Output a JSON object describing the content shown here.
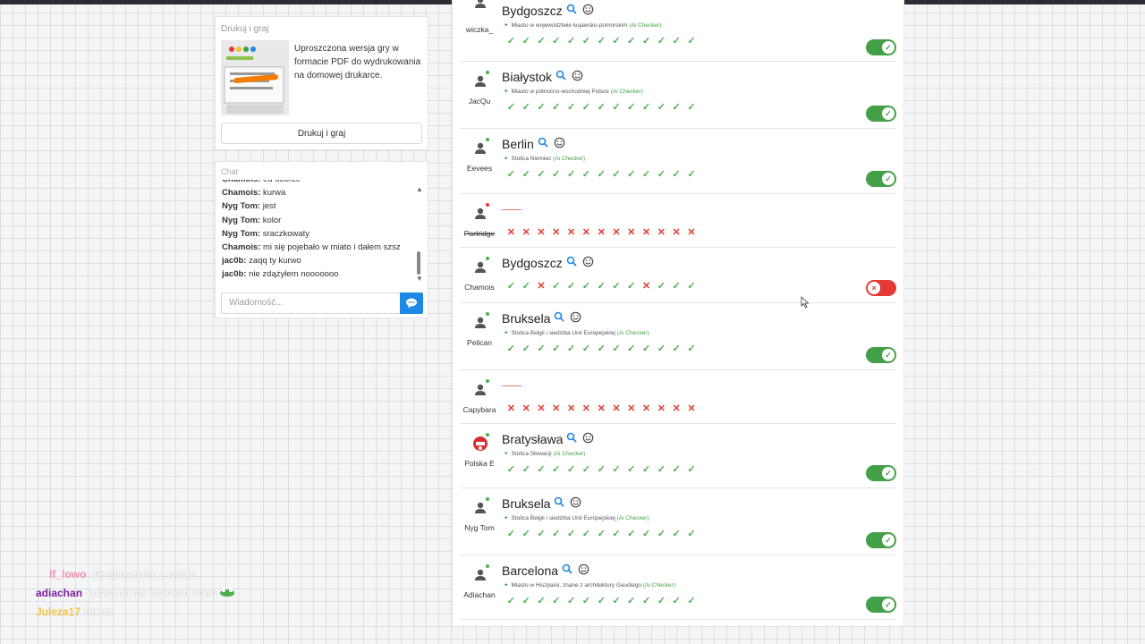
{
  "print": {
    "title": "Drukuj i graj",
    "description": "Uproszczona wersja gry w formacie PDF do wydrukowania na domowej drukarce.",
    "button": "Drukuj i graj"
  },
  "chat": {
    "title": "Chat",
    "placeholder": "Wiadomość...",
    "messages": [
      {
        "user": "Chamois:",
        "text": "eu dobrze"
      },
      {
        "user": "Chamois:",
        "text": "kurwa"
      },
      {
        "user": "Nyg Tom:",
        "text": "jest"
      },
      {
        "user": "Nyg Tom:",
        "text": "kolor"
      },
      {
        "user": "Nyg Tom:",
        "text": "sraczkowaty"
      },
      {
        "user": "Chamois:",
        "text": "mi się pojebało w miato i dałem szsz"
      },
      {
        "user": "jac0b:",
        "text": "zaqq ty kurwo"
      },
      {
        "user": "jac0b:",
        "text": "nie zdążyłem nooooooo"
      }
    ]
  },
  "answers": [
    {
      "player": "wiczka_",
      "word": "Bydgoszcz",
      "desc": "Miasto w województwie kujawsko-pomorskim",
      "ai": "(Ai Checker)",
      "votes": "ccccccccccccc",
      "toggle": "on",
      "online": true,
      "strike": false
    },
    {
      "player": "JacQu",
      "word": "Białystok",
      "desc": "Miasto w północno-wschodniej Polsce",
      "ai": "(Ai Checker)",
      "votes": "ccccccccccccc",
      "toggle": "on",
      "online": true,
      "strike": false
    },
    {
      "player": "Eevees",
      "word": "Berlin",
      "desc": "Stolica Niemiec",
      "ai": "(Ai Checker)",
      "votes": "ccccccccccccc",
      "toggle": "on",
      "online": true,
      "strike": false
    },
    {
      "player": "Partridge",
      "word": "",
      "desc": "",
      "ai": "",
      "votes": "xxxxxxxxxxxxx",
      "toggle": "none",
      "online": false,
      "strike": true
    },
    {
      "player": "Chamois",
      "word": "Bydgoszcz",
      "desc": "",
      "ai": "",
      "votes": "ccxccccccxccc",
      "toggle": "off",
      "online": true,
      "strike": false
    },
    {
      "player": "Pelican",
      "word": "Bruksela",
      "desc": "Stolica Belgii i siedziba Unii Europejskiej",
      "ai": "(Ai Checker)",
      "votes": "ccccccccccccc",
      "toggle": "on",
      "online": true,
      "strike": false
    },
    {
      "player": "Capybara",
      "word": "",
      "desc": "",
      "ai": "",
      "votes": "xxxxxxxxxxxxx",
      "toggle": "none",
      "online": true,
      "strike": false
    },
    {
      "player": "Polska E",
      "word": "Bratysława",
      "desc": "Stolica Słowacji",
      "ai": "(Ai Checker)",
      "votes": "ccccccccccccc",
      "toggle": "on",
      "online": true,
      "strike": false
    },
    {
      "player": "Nyg Tom",
      "word": "Bruksela",
      "desc": "Stolica Belgii i siedziba Unii Europejskiej",
      "ai": "(Ai Checker)",
      "votes": "ccccccccccccc",
      "toggle": "on",
      "online": true,
      "strike": false
    },
    {
      "player": "Adiachan",
      "word": "Barcelona",
      "desc": "Miasto w Hiszpanii, znane z architektury Gaudiego",
      "ai": "(Ai Checker)",
      "votes": "ccccccccccccc",
      "toggle": "on",
      "online": true,
      "strike": false
    }
  ],
  "overlay": [
    {
      "user": "lf_lowo",
      "text": "ale spocepiec z ciebie",
      "color": "#f48fb1"
    },
    {
      "user": "adiachan",
      "text": "kurwa co tak szybkoo nooo",
      "color": "#7b1fa2"
    },
    {
      "user": "Juleza17",
      "text": "rel oh",
      "color": "#f4c542"
    }
  ],
  "colors": {
    "ok": "#4caf50",
    "no": "#e53935",
    "accent": "#1e88e5",
    "online": "#4caf50",
    "offline": "#e53935"
  }
}
